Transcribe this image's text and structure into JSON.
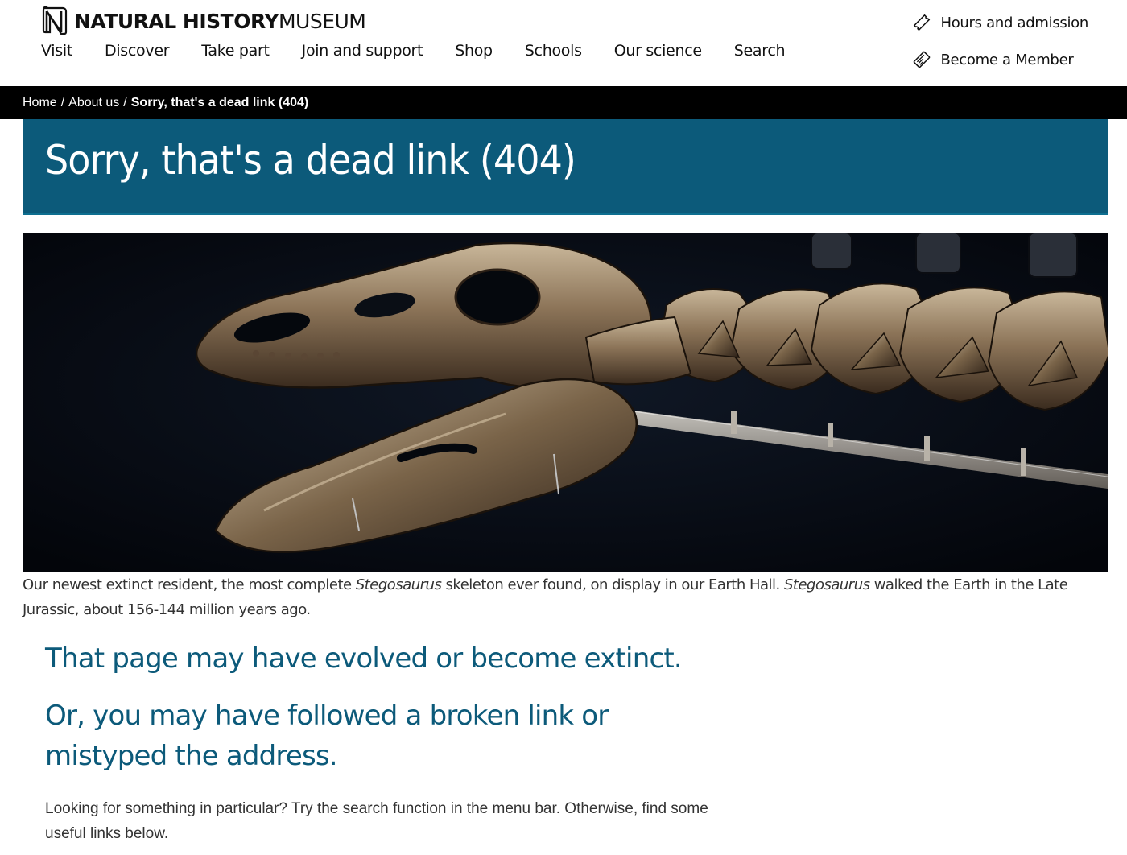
{
  "header": {
    "logo": {
      "bold_text": "NATURAL HISTORY",
      "light_text": "MUSEUM",
      "icon": "nhm-n-logo-icon"
    },
    "nav": [
      "Visit",
      "Discover",
      "Take part",
      "Join and support",
      "Shop",
      "Schools",
      "Our science",
      "Search"
    ],
    "utility": [
      {
        "label": "Hours and admission",
        "icon": "ticket-icon"
      },
      {
        "label": "Become a Member",
        "icon": "membership-card-icon"
      }
    ]
  },
  "breadcrumb": {
    "items": [
      "Home",
      "About us"
    ],
    "separator": "/",
    "current": "Sorry, that's a dead link (404)"
  },
  "page": {
    "title": "Sorry, that's a dead link (404)",
    "caption": {
      "part1": "Our newest extinct resident, the most complete ",
      "italic1": "Stegosaurus",
      "part2": " skeleton ever found, on display in our Earth Hall. ",
      "italic2": "Stegosaurus",
      "part3": " walked the Earth in the Late Jurassic, about 156-144 million years ago."
    },
    "heading1": "That page may have evolved or become extinct.",
    "heading2": "Or, you may have followed a broken link or mistyped the address.",
    "lead": "Looking for something in particular? Try the search function in the menu bar. Otherwise, find some useful links below."
  },
  "colors": {
    "banner": "#0c5a7a",
    "heading_text": "#0c5a7a",
    "breadcrumb_bg": "#000000"
  }
}
